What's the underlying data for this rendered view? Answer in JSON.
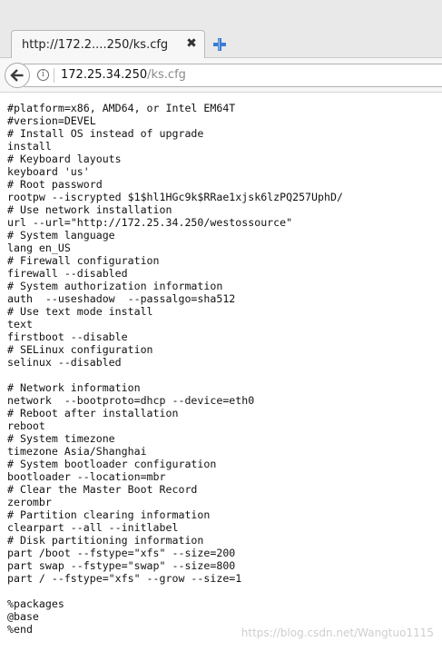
{
  "tab": {
    "title": "http://172.2....250/ks.cfg",
    "close_glyph": "✖"
  },
  "nav": {
    "url_host": "172.25.34.250",
    "url_path": "/ks.cfg",
    "info_glyph": "i"
  },
  "icons": {
    "back": "back-arrow-icon",
    "info": "info-icon",
    "close": "close-icon",
    "new_tab": "plus-icon",
    "new_tab_color": "#3b7bd6"
  },
  "file_content": "#platform=x86, AMD64, or Intel EM64T\n#version=DEVEL\n# Install OS instead of upgrade\ninstall\n# Keyboard layouts\nkeyboard 'us'\n# Root password\nrootpw --iscrypted $1$hl1HGc9k$RRae1xjsk6lzPQ257UphD/\n# Use network installation\nurl --url=\"http://172.25.34.250/westossource\"\n# System language\nlang en_US\n# Firewall configuration\nfirewall --disabled\n# System authorization information\nauth  --useshadow  --passalgo=sha512\n# Use text mode install\ntext\nfirstboot --disable\n# SELinux configuration\nselinux --disabled\n\n# Network information\nnetwork  --bootproto=dhcp --device=eth0\n# Reboot after installation\nreboot\n# System timezone\ntimezone Asia/Shanghai\n# System bootloader configuration\nbootloader --location=mbr\n# Clear the Master Boot Record\nzerombr\n# Partition clearing information\nclearpart --all --initlabel\n# Disk partitioning information\npart /boot --fstype=\"xfs\" --size=200\npart swap --fstype=\"swap\" --size=800\npart / --fstype=\"xfs\" --grow --size=1\n\n%packages\n@base\n%end",
  "watermark": "https://blog.csdn.net/Wangtuo1115"
}
